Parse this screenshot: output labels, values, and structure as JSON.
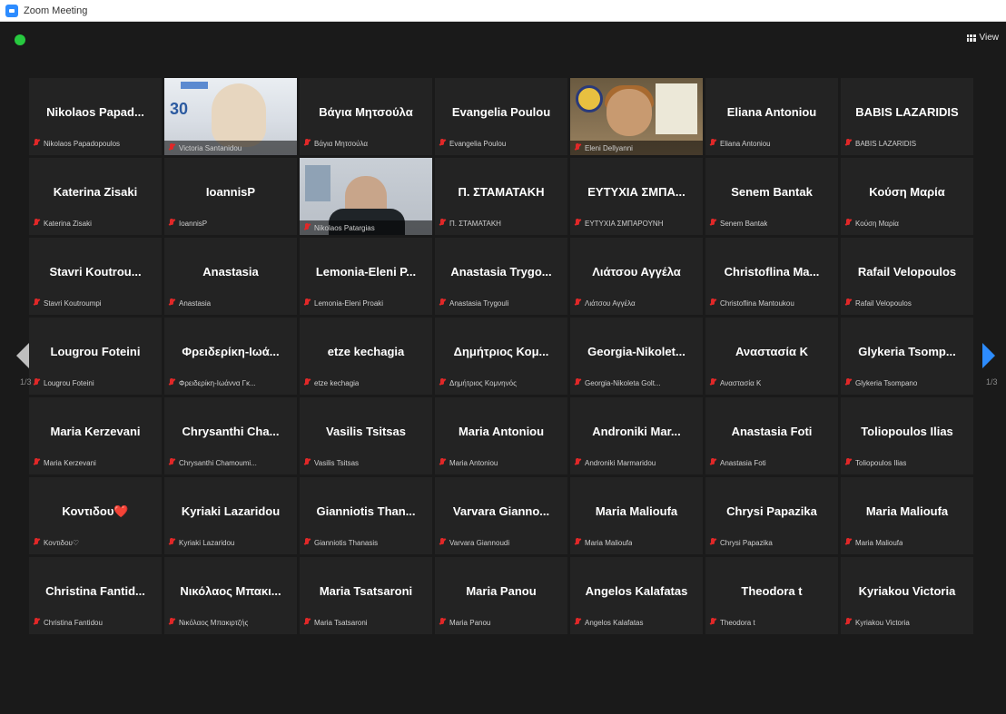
{
  "window": {
    "title": "Zoom Meeting"
  },
  "toolbar": {
    "view_label": "View"
  },
  "pagination": {
    "left": "1/3",
    "right": "1/3"
  },
  "colors": {
    "accent": "#2d8cff",
    "active_speaker": "#cfe55b",
    "muted": "#e02828",
    "background": "#1a1a1a",
    "tile": "#232323"
  },
  "participants": [
    {
      "name": "Nikolaos Papad...",
      "sub": "Nikolaos Papadopoulos"
    },
    {
      "name": "",
      "sub": "Victoria Santanidou",
      "video": "a"
    },
    {
      "name": "Βάγια Μητσούλα",
      "sub": "Βάγια Μητσούλα"
    },
    {
      "name": "Evangelia Poulou",
      "sub": "Evangelia Poulou"
    },
    {
      "name": "",
      "sub": "Eleni Dellyanni",
      "video": "c"
    },
    {
      "name": "Eliana Antoniou",
      "sub": "Eliana Antoniou"
    },
    {
      "name": "BABIS LAZARIDIS",
      "sub": "BABIS LAZARIDIS"
    },
    {
      "name": "Katerina Zisaki",
      "sub": "Katerina Zisaki"
    },
    {
      "name": "IoannisP",
      "sub": "IoannisP"
    },
    {
      "name": "",
      "sub": "Nikolaos Patargias",
      "video": "b",
      "active": true
    },
    {
      "name": "Π. ΣΤΑΜΑΤΑΚΗ",
      "sub": "Π. ΣΤΑΜΑΤΑΚΗ"
    },
    {
      "name": "ΕΥΤΥΧΙΑ ΣΜΠΑ...",
      "sub": "ΕΥΤΥΧΙΑ ΣΜΠΑΡΟΥΝΗ"
    },
    {
      "name": "Senem Bantak",
      "sub": "Senem Bantak"
    },
    {
      "name": "Κούση Μαρία",
      "sub": "Κούση Μαρία"
    },
    {
      "name": "Stavri Koutrou...",
      "sub": "Stavri Koutroumpi"
    },
    {
      "name": "Anastasia",
      "sub": "Anastasia"
    },
    {
      "name": "Lemonia-Eleni P...",
      "sub": "Lemonia-Eleni Proaki"
    },
    {
      "name": "Anastasia Trygo...",
      "sub": "Anastasia Trygouli"
    },
    {
      "name": "Λιάτσου Αγγέλα",
      "sub": "Λιάτσου Αγγέλα"
    },
    {
      "name": "Christoflina Ma...",
      "sub": "Christoflina Mantoukou"
    },
    {
      "name": "Rafail Velopoulos",
      "sub": "Rafail Velopoulos"
    },
    {
      "name": "Lougrou Foteini",
      "sub": "Lougrou Foteini"
    },
    {
      "name": "Φρειδερίκη-Ιωά...",
      "sub": "Φρειδερίκη-Ιωάννα Γκ..."
    },
    {
      "name": "etze kechagia",
      "sub": "etze kechagia"
    },
    {
      "name": "Δημήτριος Κομ...",
      "sub": "Δημήτριος Κομνηνός"
    },
    {
      "name": "Georgia-Nikolet...",
      "sub": "Georgia-Nikoleta Golt..."
    },
    {
      "name": "Αναστασία Κ",
      "sub": "Αναστασία Κ"
    },
    {
      "name": "Glykeria Tsomp...",
      "sub": "Glykeria Tsompano"
    },
    {
      "name": "Maria Kerzevani",
      "sub": "Maria Kerzevani"
    },
    {
      "name": "Chrysanthi Cha...",
      "sub": "Chrysanthi Chamoumi..."
    },
    {
      "name": "Vasilis Tsitsas",
      "sub": "Vasilis Tsitsas"
    },
    {
      "name": "Maria Antoniou",
      "sub": "Maria Antoniou"
    },
    {
      "name": "Androniki Mar...",
      "sub": "Androniki Marmaridou"
    },
    {
      "name": "Anastasia Foti",
      "sub": "Anastasia Foti"
    },
    {
      "name": "Toliopoulos Ilias",
      "sub": "Toliopoulos Ilias"
    },
    {
      "name": "Κοντιδου❤️",
      "sub": "Κοντιδου♡"
    },
    {
      "name": "Kyriaki Lazaridou",
      "sub": "Kyriaki Lazaridou"
    },
    {
      "name": "Gianniotis Than...",
      "sub": "Gianniotis Thanasis"
    },
    {
      "name": "Varvara Gianno...",
      "sub": "Varvara Giannoudi"
    },
    {
      "name": "Maria Malioufa",
      "sub": "Maria Malioufa"
    },
    {
      "name": "Chrysi Papazika",
      "sub": "Chrysi Papazika"
    },
    {
      "name": "Maria Malioufa",
      "sub": "Maria Malioufa"
    },
    {
      "name": "Christina Fantid...",
      "sub": "Christina Fantidou"
    },
    {
      "name": "Νικόλαος Μπακι...",
      "sub": "Νικόλαος Μπακιρτζής"
    },
    {
      "name": "Maria Tsatsaroni",
      "sub": "Maria Tsatsaroni"
    },
    {
      "name": "Maria Panou",
      "sub": "Maria Panou"
    },
    {
      "name": "Angelos Kalafatas",
      "sub": "Angelos Kalafatas"
    },
    {
      "name": "Theodora t",
      "sub": "Theodora t"
    },
    {
      "name": "Kyriakou Victoria",
      "sub": "Kyriakou Victoria"
    }
  ]
}
